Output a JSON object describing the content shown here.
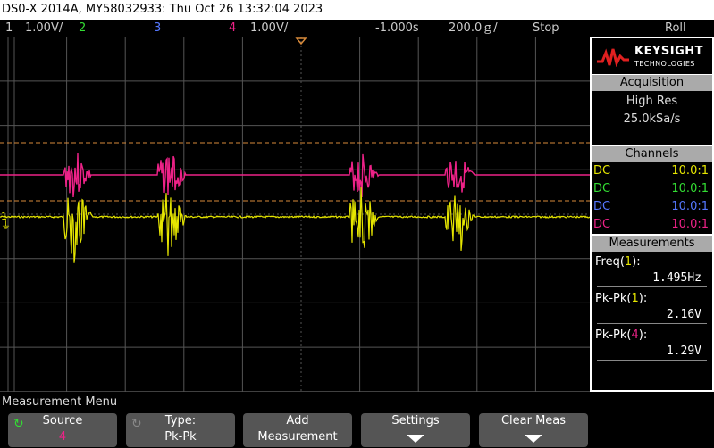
{
  "title": "DS0-X 2014A, MY58032933: Thu Oct 26 13:32:04 2023",
  "status": {
    "ch1_num": "1",
    "ch1_scale": "1.00V/",
    "ch2_num": "2",
    "ch3_num": "3",
    "ch4_num": "4",
    "ch4_scale": "1.00V/",
    "time_delay": "-1.000s",
    "time_scale": "200.0ｇ/",
    "run_state": "Stop",
    "trigger_mode": "Roll"
  },
  "markers": {
    "ch1_marker": "1"
  },
  "colors": {
    "ch1": "#e6e600",
    "ch2": "#33dd33",
    "ch3": "#5577ff",
    "ch4": "#ee2288",
    "trigger_line": "#d88a3a",
    "grid": "#555555"
  },
  "logo": {
    "brand": "KEYSIGHT",
    "sub": "TECHNOLOGIES"
  },
  "acquisition": {
    "header": "Acquisition",
    "mode": "High Res",
    "rate": "25.0kSa/s"
  },
  "channels": {
    "header": "Channels",
    "rows": [
      {
        "coupling": "DC",
        "ratio": "10.0:1"
      },
      {
        "coupling": "DC",
        "ratio": "10.0:1"
      },
      {
        "coupling": "DC",
        "ratio": "10.0:1"
      },
      {
        "coupling": "DC",
        "ratio": "10.0:1"
      }
    ]
  },
  "measurements": {
    "header": "Measurements",
    "items": [
      {
        "label": "Freq(",
        "ch": "1",
        "close": "):",
        "value": "1.495Hz"
      },
      {
        "label": "Pk-Pk(",
        "ch": "1",
        "close": "):",
        "value": "2.16V"
      },
      {
        "label": "Pk-Pk(",
        "ch": "4",
        "close": "):",
        "value": "1.29V"
      }
    ]
  },
  "menu": {
    "title": "Measurement Menu",
    "softkeys": [
      {
        "line1": "Source",
        "line2": "4"
      },
      {
        "line1": "Type:",
        "line2": "Pk-Pk"
      },
      {
        "line1": "Add",
        "line2": "Measurement"
      },
      {
        "line1": "Settings",
        "line2": ""
      },
      {
        "line1": "Clear Meas",
        "line2": ""
      }
    ]
  }
}
